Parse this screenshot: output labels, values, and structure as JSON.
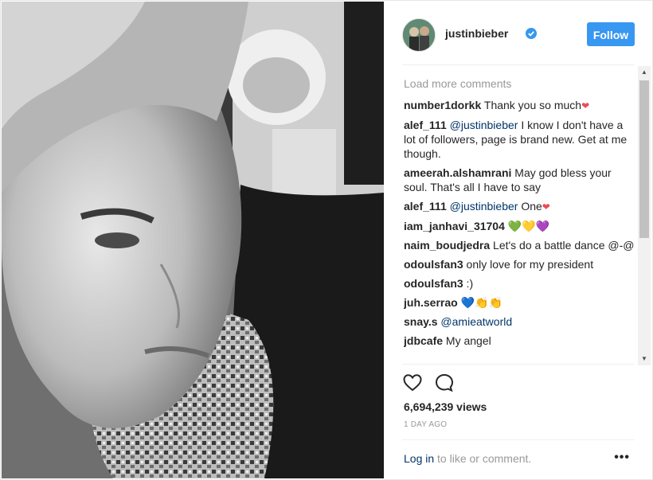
{
  "post": {
    "username": "justinbieber",
    "follow_label": "Follow",
    "load_more": "Load more comments",
    "views": "6,694,239 views",
    "time": "1 DAY AGO",
    "login_link": "Log in",
    "login_rest": " to like or comment.",
    "more_label": "•••"
  },
  "comments": [
    {
      "user": "number1dorkk",
      "text": " Thank you so much",
      "suffix": "❤"
    },
    {
      "user": "alef_111",
      "mention": " @justinbieber",
      "text": " I know I don't have a lot of followers, page is brand new. Get at me though."
    },
    {
      "user": "ameerah.alshamrani",
      "text": " May god bless your soul. That's all I have to say"
    },
    {
      "user": "alef_111",
      "mention": " @justinbieber",
      "text": " One",
      "suffix": "❤"
    },
    {
      "user": "iam_janhavi_31704",
      "text": " ",
      "emoji": "💚💛💜"
    },
    {
      "user": "naim_boudjedra",
      "text": " Let's do a battle dance @-@"
    },
    {
      "user": "odoulsfan3",
      "text": " only love for my president"
    },
    {
      "user": "odoulsfan3",
      "text": " :)"
    },
    {
      "user": "juh.serrao",
      "text": " ",
      "emoji": "💙👏👏"
    },
    {
      "user": "snay.s",
      "mention": " @amieatworld",
      "text": ""
    },
    {
      "user": "jdbcafe",
      "text": " My angel"
    }
  ],
  "icons": {
    "like": "heart-outline-icon",
    "comment": "comment-bubble-icon",
    "verified": "verified-badge-icon"
  },
  "colors": {
    "accent": "#3897f0",
    "mention": "#003569",
    "muted": "#999999"
  }
}
